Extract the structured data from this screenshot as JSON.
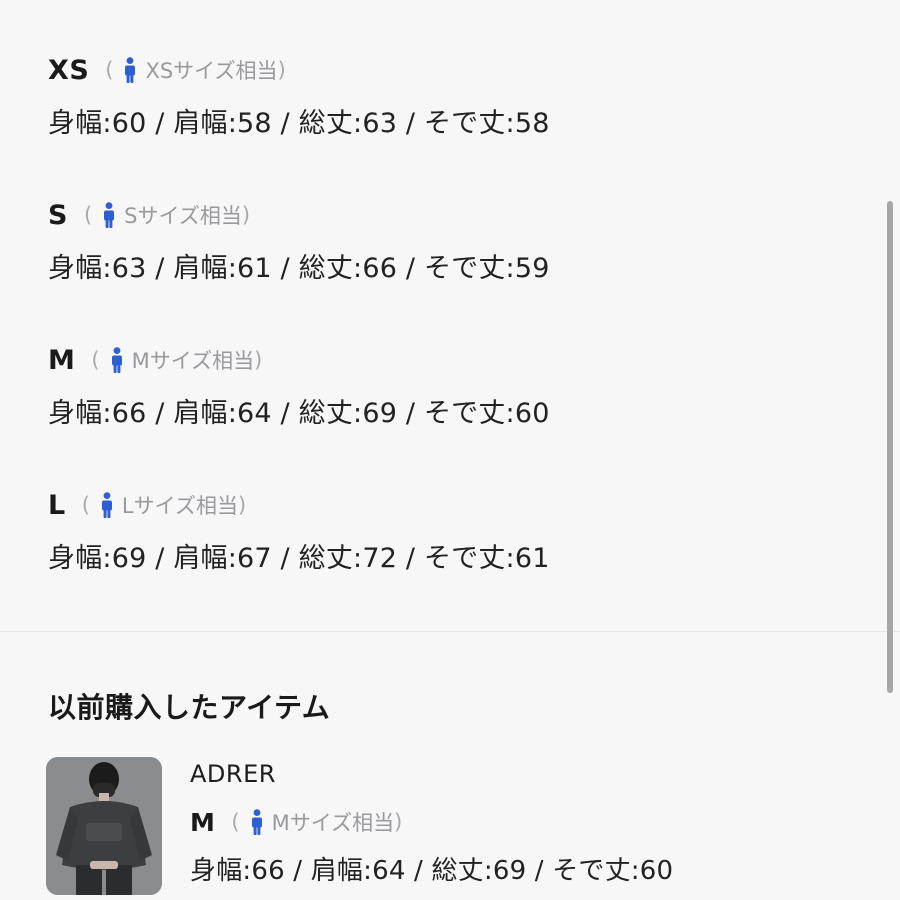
{
  "sizes": [
    {
      "code": "XS",
      "equiv_open": "(",
      "equiv_label": "XSサイズ相当",
      "equiv_close": ")",
      "measurements": "身幅:60 / 肩幅:58 / 総丈:63 / そで丈:58"
    },
    {
      "code": "S",
      "equiv_open": "(",
      "equiv_label": "Sサイズ相当",
      "equiv_close": ")",
      "measurements": "身幅:63 / 肩幅:61 / 総丈:66 / そで丈:59"
    },
    {
      "code": "M",
      "equiv_open": "(",
      "equiv_label": "Mサイズ相当",
      "equiv_close": ")",
      "measurements": "身幅:66 / 肩幅:64 / 総丈:69 / そで丈:60"
    },
    {
      "code": "L",
      "equiv_open": "(",
      "equiv_label": "Lサイズ相当",
      "equiv_close": ")",
      "measurements": "身幅:69 / 肩幅:67 / 総丈:72 / そで丈:61"
    }
  ],
  "previous": {
    "title": "以前購入したアイテム",
    "item": {
      "brand": "ADRER",
      "size_code": "M",
      "equiv_open": "(",
      "equiv_label": "Mサイズ相当",
      "equiv_close": ")",
      "measurements": "身幅:66 / 肩幅:64 / 総丈:69 / そで丈:60"
    }
  },
  "icons": {
    "person": "person-icon"
  },
  "colors": {
    "person_icon": "#2d5fd3",
    "equiv_text": "#9a9a9e",
    "background": "#f7f7f8"
  }
}
